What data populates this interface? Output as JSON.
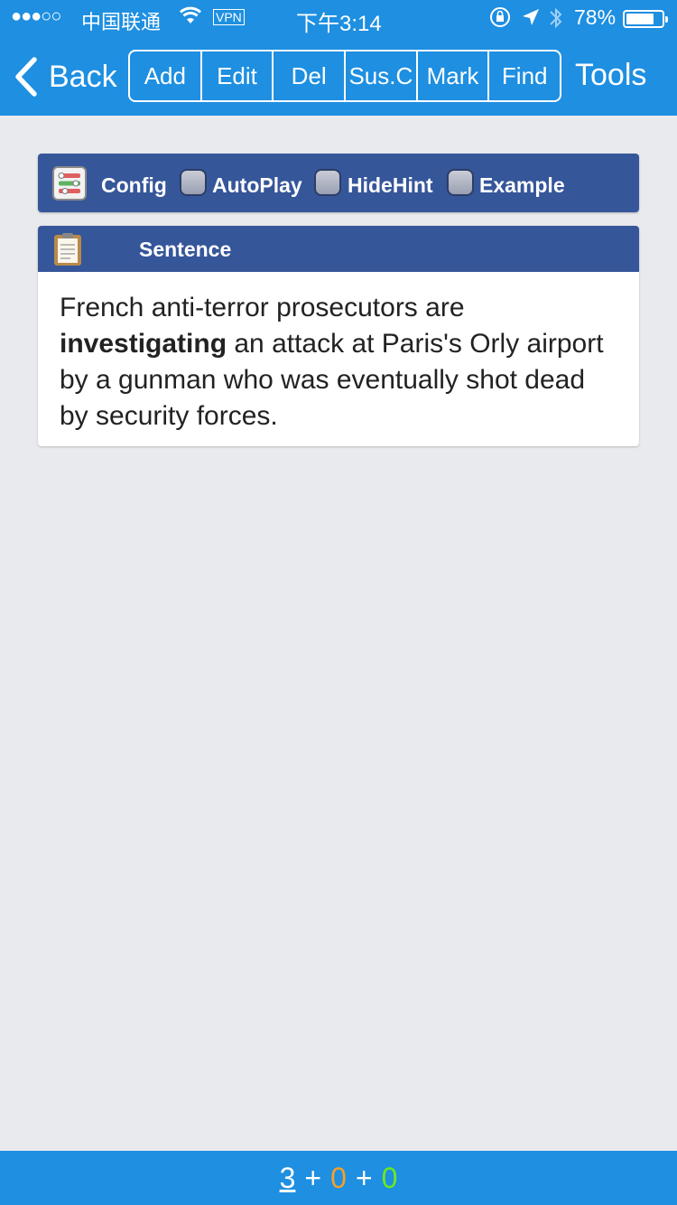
{
  "status_bar": {
    "signal_dots": "●●●○○",
    "carrier": "中国联通",
    "vpn": "VPN",
    "time": "下午3:14",
    "battery_text": "78%",
    "battery_level": 0.78
  },
  "nav": {
    "back_label": "Back",
    "segments": [
      "Add",
      "Edit",
      "Del",
      "Sus.C",
      "Mark",
      "Find"
    ],
    "tools_label": "Tools"
  },
  "config": {
    "label": "Config",
    "options": [
      {
        "label": "AutoPlay",
        "checked": false
      },
      {
        "label": "HideHint",
        "checked": false
      },
      {
        "label": "Example",
        "checked": false
      }
    ]
  },
  "sentence": {
    "header": "Sentence",
    "text_before": "French anti-terror prosecutors are ",
    "highlight": "investigating",
    "text_after": " an attack at Paris's Orly airport by a gunman who was eventually shot dead by security forces."
  },
  "counter": {
    "a": "3",
    "plus1": "+",
    "b": "0",
    "plus2": "+",
    "c": "0"
  },
  "colors": {
    "bar_blue": "#1e8fe1",
    "panel_blue": "#36569a",
    "count_orange": "#f5a028",
    "count_green": "#6ee820"
  }
}
